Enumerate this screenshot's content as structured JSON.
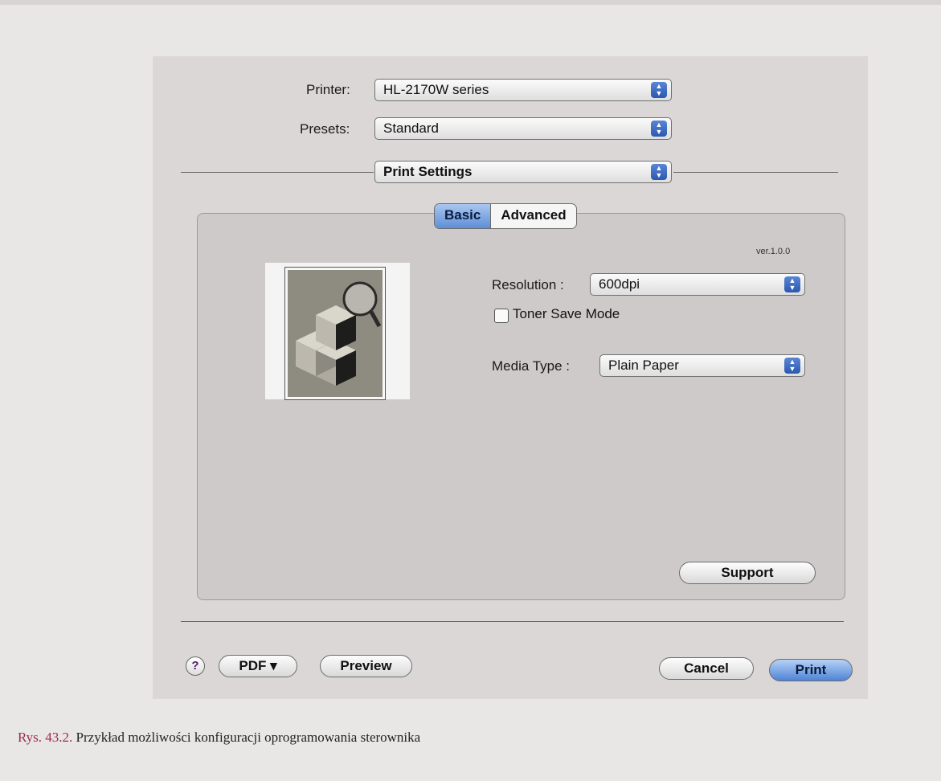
{
  "dialog": {
    "printer_label": "Printer:",
    "printer_value": "HL-2170W series",
    "presets_label": "Presets:",
    "presets_value": "Standard",
    "panel_selector": "Print Settings"
  },
  "tabs": {
    "basic": "Basic",
    "advanced": "Advanced",
    "selected": "Basic"
  },
  "panel": {
    "version": "ver.1.0.0",
    "resolution_label": "Resolution :",
    "resolution_value": "600dpi",
    "toner_save_label": "Toner Save Mode",
    "toner_save_checked": false,
    "media_type_label": "Media Type :",
    "media_type_value": "Plain Paper",
    "support_button": "Support"
  },
  "footer": {
    "help_symbol": "?",
    "pdf_button": "PDF ▾",
    "preview_button": "Preview",
    "cancel_button": "Cancel",
    "print_button": "Print"
  },
  "caption": {
    "figure_label": "Rys. 43.2.",
    "text": " Przykład możliwości konfiguracji oprogramowania sterownika"
  }
}
